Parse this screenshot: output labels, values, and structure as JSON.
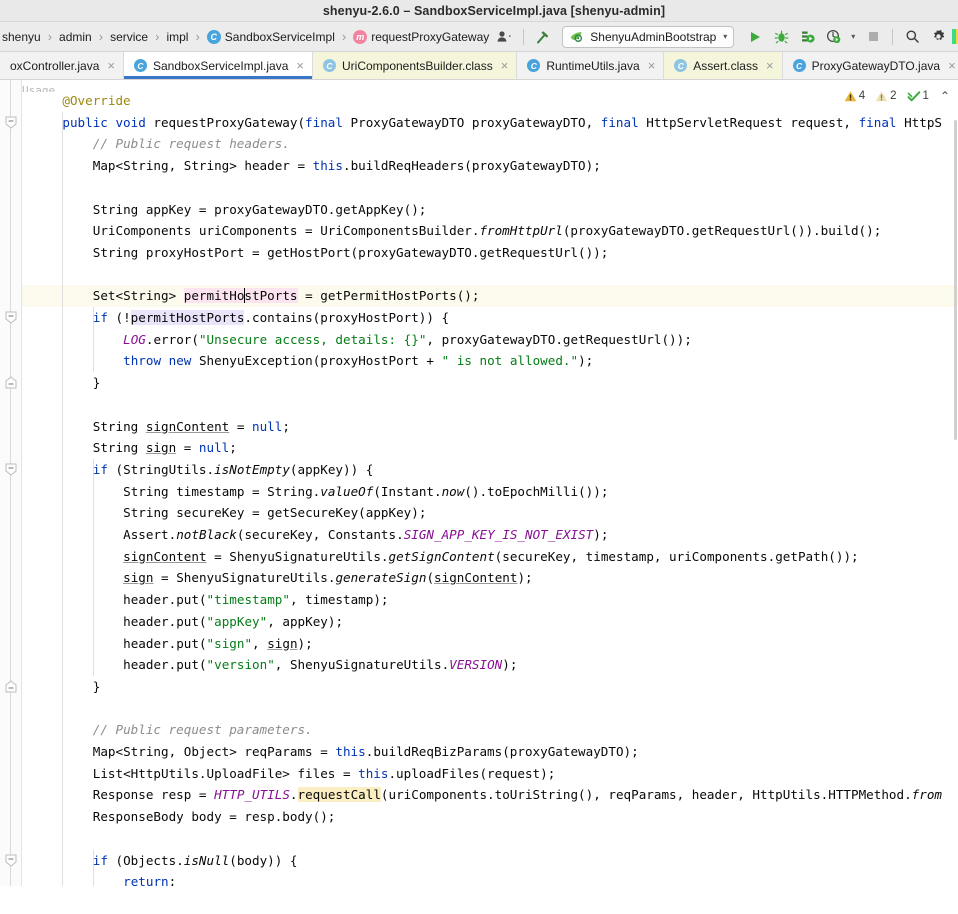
{
  "window": {
    "title": "shenyu-2.6.0 – SandboxServiceImpl.java [shenyu-admin]"
  },
  "breadcrumb": {
    "items": [
      {
        "label": "shenyu",
        "icon": ""
      },
      {
        "label": "admin",
        "icon": ""
      },
      {
        "label": "service",
        "icon": ""
      },
      {
        "label": "impl",
        "icon": ""
      },
      {
        "label": "SandboxServiceImpl",
        "icon": "class-badge-icon",
        "badge": "C",
        "badge_type": "cls"
      },
      {
        "label": "requestProxyGateway",
        "icon": "method-badge-icon",
        "badge": "m",
        "badge_type": "mth"
      }
    ],
    "separator": "›"
  },
  "toolbar": {
    "profile_label": "",
    "run_config": "ShenyuAdminBootstrap",
    "buttons": [
      {
        "name": "user-profile-icon",
        "label": ""
      },
      {
        "name": "hammer-build-icon",
        "label": ""
      },
      {
        "name": "run-icon",
        "label": ""
      },
      {
        "name": "debug-icon",
        "label": ""
      },
      {
        "name": "run-coverage-icon",
        "label": ""
      },
      {
        "name": "profiler-icon",
        "label": ""
      },
      {
        "name": "stop-icon",
        "label": ""
      },
      {
        "name": "search-icon",
        "label": ""
      },
      {
        "name": "settings-gear-icon",
        "label": ""
      },
      {
        "name": "app-color-icon",
        "label": ""
      }
    ],
    "caret": "▾"
  },
  "tabs": [
    {
      "label": "oxController.java",
      "icon": "",
      "state": "truncated"
    },
    {
      "label": "SandboxServiceImpl.java",
      "icon": "C",
      "state": "active"
    },
    {
      "label": "UriComponentsBuilder.class",
      "icon": "C",
      "state": "class"
    },
    {
      "label": "RuntimeUtils.java",
      "icon": "C",
      "state": "normal"
    },
    {
      "label": "Assert.class",
      "icon": "C",
      "state": "class"
    },
    {
      "label": "ProxyGatewayDTO.java",
      "icon": "C",
      "state": "normal"
    }
  ],
  "tab_overflow": {
    "icon": "I",
    "chevron": "⌄"
  },
  "tab_close_glyph": "×",
  "inspections": {
    "warnings_icon": "warning-triangle-icon",
    "warnings": "4",
    "weak_warnings_icon": "weak-warning-triangle-icon",
    "weak_warnings": "2",
    "checkmark_icon": "inspection-checkmark-icon",
    "other": "1",
    "collapse_icon": "chevron-up-icon",
    "collapse": "⌃"
  },
  "editor": {
    "partial_top_text": "Usage",
    "cursor_line_index": 9,
    "lines": [
      {
        "i": 0,
        "indent": 4,
        "html": "<span class='ann'>@Override</span>"
      },
      {
        "i": 1,
        "indent": 4,
        "html": "<span class='kw'>public</span> <span class='kw'>void</span> requestProxyGateway(<span class='kw'>final</span> ProxyGatewayDTO proxyGatewayDTO, <span class='kw'>final</span> HttpServletRequest request, <span class='kw'>final</span> HttpS"
      },
      {
        "i": 2,
        "indent": 8,
        "html": "<span class='cmt'>// Public request headers.</span>"
      },
      {
        "i": 3,
        "indent": 8,
        "html": "Map&lt;String, String&gt; header = <span class='kw'>this</span>.buildReqHeaders(proxyGatewayDTO);"
      },
      {
        "i": 4,
        "indent": 0,
        "html": ""
      },
      {
        "i": 5,
        "indent": 8,
        "html": "String appKey = proxyGatewayDTO.getAppKey();"
      },
      {
        "i": 6,
        "indent": 8,
        "html": "UriComponents uriComponents = UriComponentsBuilder.<span class='ital'>fromHttpUrl</span>(proxyGatewayDTO.getRequestUrl()).build();"
      },
      {
        "i": 7,
        "indent": 8,
        "html": "String proxyHostPort = getHostPort(proxyGatewayDTO.getRequestUrl());"
      },
      {
        "i": 8,
        "indent": 0,
        "html": ""
      },
      {
        "i": 9,
        "indent": 8,
        "html": "Set&lt;String&gt; <span class='hl-ident'>permitHo<span class='cursor'></span>stPorts</span> = getPermitHostPorts();"
      },
      {
        "i": 10,
        "indent": 8,
        "html": "<span class='kw'>if</span> (!<span class='hl-usage'>permitHostPorts</span>.contains(proxyHostPort)) {"
      },
      {
        "i": 11,
        "indent": 12,
        "html": "<span class='sfld'>LOG</span>.error(<span class='str'>\"Unsecure access, details: {}\"</span>, proxyGatewayDTO.getRequestUrl());"
      },
      {
        "i": 12,
        "indent": 12,
        "html": "<span class='kw'>throw</span> <span class='kw'>new</span> ShenyuException(proxyHostPort + <span class='str'>\" is not allowed.\"</span>);"
      },
      {
        "i": 13,
        "indent": 8,
        "html": "}"
      },
      {
        "i": 14,
        "indent": 0,
        "html": ""
      },
      {
        "i": 15,
        "indent": 8,
        "html": "String <span class='und'>signContent</span> = <span class='kw'>null</span>;"
      },
      {
        "i": 16,
        "indent": 8,
        "html": "String <span class='und'>sign</span> = <span class='kw'>null</span>;"
      },
      {
        "i": 17,
        "indent": 8,
        "html": "<span class='kw'>if</span> (StringUtils.<span class='ital'>isNotEmpty</span>(appKey)) {"
      },
      {
        "i": 18,
        "indent": 12,
        "html": "String timestamp = String.<span class='ital'>valueOf</span>(Instant.<span class='ital'>now</span>().toEpochMilli());"
      },
      {
        "i": 19,
        "indent": 12,
        "html": "String secureKey = getSecureKey(appKey);"
      },
      {
        "i": 20,
        "indent": 12,
        "html": "Assert.<span class='ital'>notBlack</span>(secureKey, Constants.<span class='sfld'>SIGN_APP_KEY_IS_NOT_EXIST</span>);"
      },
      {
        "i": 21,
        "indent": 12,
        "html": "<span class='und'>signContent</span> = ShenyuSignatureUtils.<span class='ital'>getSignContent</span>(secureKey, timestamp, uriComponents.getPath());"
      },
      {
        "i": 22,
        "indent": 12,
        "html": "<span class='und'>sign</span> = ShenyuSignatureUtils.<span class='ital'>generateSign</span>(<span class='und'>signContent</span>);"
      },
      {
        "i": 23,
        "indent": 12,
        "html": "header.put(<span class='str'>\"timestamp\"</span>, timestamp);"
      },
      {
        "i": 24,
        "indent": 12,
        "html": "header.put(<span class='str'>\"appKey\"</span>, appKey);"
      },
      {
        "i": 25,
        "indent": 12,
        "html": "header.put(<span class='str'>\"sign\"</span>, <span class='und'>sign</span>);"
      },
      {
        "i": 26,
        "indent": 12,
        "html": "header.put(<span class='str'>\"version\"</span>, ShenyuSignatureUtils.<span class='sfld'>VERSION</span>);"
      },
      {
        "i": 27,
        "indent": 8,
        "html": "}"
      },
      {
        "i": 28,
        "indent": 0,
        "html": ""
      },
      {
        "i": 29,
        "indent": 8,
        "html": "<span class='cmt'>// Public request parameters.</span>"
      },
      {
        "i": 30,
        "indent": 8,
        "html": "Map&lt;String, Object&gt; reqParams = <span class='kw'>this</span>.buildReqBizParams(proxyGatewayDTO);"
      },
      {
        "i": 31,
        "indent": 8,
        "html": "List&lt;HttpUtils.UploadFile&gt; files = <span class='kw'>this</span>.uploadFiles(request);"
      },
      {
        "i": 32,
        "indent": 8,
        "html": "Response resp = <span class='sfld'>HTTP_UTILS</span>.<span class='hl-call'>requestCall</span>(uriComponents.toUriString(), reqParams, header, HttpUtils.HTTPMethod.<span class='ital'>from</span>"
      },
      {
        "i": 33,
        "indent": 8,
        "html": "ResponseBody body = resp.body();"
      },
      {
        "i": 34,
        "indent": 0,
        "html": ""
      },
      {
        "i": 35,
        "indent": 8,
        "html": "<span class='kw'>if</span> (Objects.<span class='ital'>isNull</span>(body)) {"
      },
      {
        "i": 36,
        "indent": 12,
        "html": "<span class='kw'>return</span>;"
      },
      {
        "i": 37,
        "indent": 8,
        "html": "}"
      }
    ],
    "fold_marks": [
      {
        "line": 1,
        "type": "open"
      },
      {
        "line": 10,
        "type": "open"
      },
      {
        "line": 13,
        "type": "close"
      },
      {
        "line": 17,
        "type": "open"
      },
      {
        "line": 27,
        "type": "close"
      },
      {
        "line": 35,
        "type": "open"
      },
      {
        "line": 37,
        "type": "close"
      }
    ],
    "colors": {
      "keyword": "#0033b3",
      "string": "#067d17",
      "comment": "#8c8c8c",
      "annotation": "#9e880d",
      "static_field": "#871094",
      "caret_row": "#fcfaed",
      "identifier_highlight": "#fbe4ef",
      "usage_highlight": "#eae4fb",
      "call_highlight": "#fbeec2",
      "background": "#ffffff"
    }
  }
}
